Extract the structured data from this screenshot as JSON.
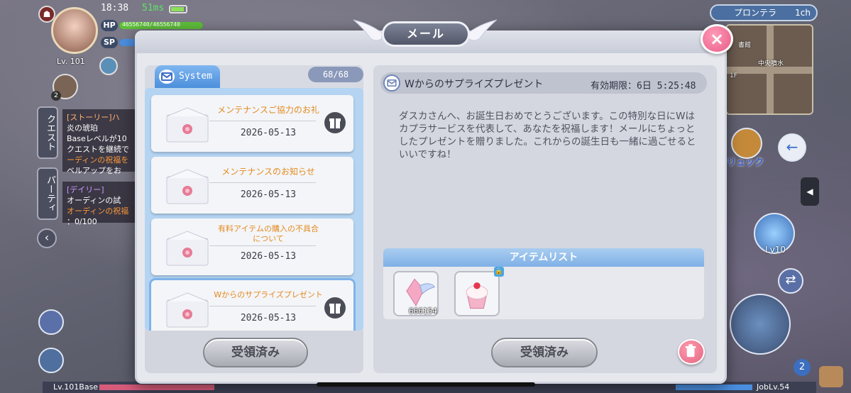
{
  "status": {
    "time": "18:38",
    "ping": "51ms"
  },
  "player": {
    "hp_label": "HP",
    "hp_value": "46556740/46556740",
    "hp_fraction": 1.0,
    "sp_label": "SP",
    "sp_fraction": 0.9,
    "level": "Lv. 101",
    "party_count": "2"
  },
  "quests": {
    "tab1": "クエスト",
    "tab2": "パーティ",
    "story": {
      "title": "[ストーリー]ハ",
      "line1": "炎の琥珀",
      "line2": "Baseレベルが10",
      "line3": "クエストを継続で",
      "line4": "ーディンの祝福を",
      "line5": "ベルアップをお"
    },
    "daily": {
      "title": "[デイリー]",
      "line1": "オーディンの試",
      "line2": "オーディンの祝福",
      "line3": "：0/100"
    }
  },
  "server": {
    "name": "プロンテラ",
    "channel": "1ch"
  },
  "minimap": {
    "label1": "中央噴水",
    "label2": "書館",
    "label3": "1F"
  },
  "right_hud": {
    "rucksack": "リュック",
    "skill_level": "Lv10",
    "notif_count": "2"
  },
  "bottom": {
    "base_level": "Lv.101Base",
    "job_level": "JobLv.54",
    "base_exp_fraction": 0.18,
    "job_exp_fraction": 0.12
  },
  "dialog": {
    "title": "メール",
    "close_label": "×",
    "tab_label": "System",
    "count": "68/68",
    "mails": [
      {
        "title": "メンテナンスご協力のお礼",
        "date": "2026-05-13",
        "gift": true
      },
      {
        "title": "メンテナンスのお知らせ",
        "date": "2026-05-13",
        "gift": false
      },
      {
        "title": "有料アイテムの購入の不具合\nについて",
        "date": "2026-05-13",
        "gift": false
      },
      {
        "title": "Wからのサプライズプレゼント",
        "date": "2026-05-13",
        "gift": true
      }
    ],
    "left_button": "受領済み",
    "detail": {
      "subject": "Wからのサプライズプレゼント",
      "expiry": "有効期限：6日 5:25:48",
      "body": "ダスカさんへ、お誕生日おめでとうございます。この特別な日にWはカプラサービスを代表して、あなたを祝福します！メールにちょっとしたプレゼントを贈りました。これからの誕生日も一緒に過ごせるといいですね！",
      "items_header": "アイテムリスト",
      "items": [
        {
          "name": "crystal-wing-item",
          "quantity": "666154"
        },
        {
          "name": "cupcake-item",
          "quantity": "",
          "locked": true
        }
      ],
      "claim_button": "受領済み"
    }
  },
  "colors": {
    "accent": "#4c8fdc",
    "mail_title": "#e38a1f",
    "close": "#e85a86"
  }
}
